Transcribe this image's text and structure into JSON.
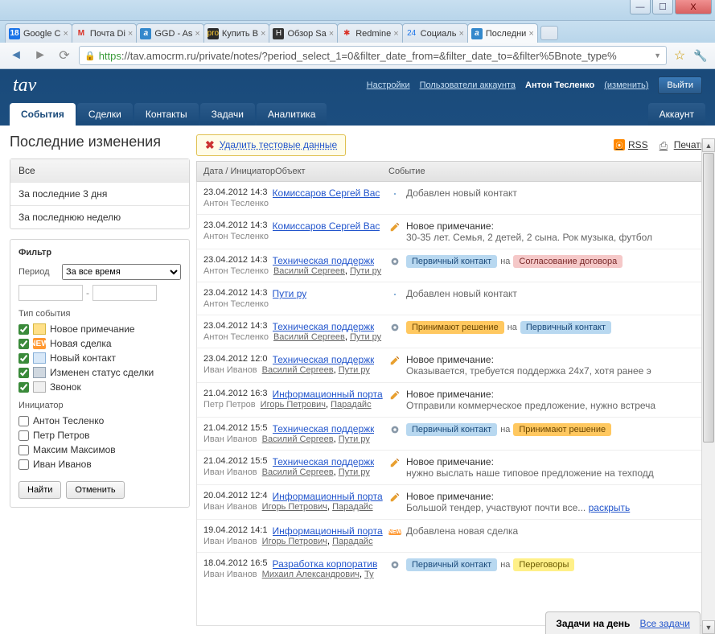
{
  "window": {
    "min": "—",
    "max": "☐",
    "close": "X"
  },
  "tabs": [
    {
      "label": "Google C",
      "fav": "18",
      "favcls": "fav-cal"
    },
    {
      "label": "Почта Di",
      "fav": "M",
      "favcls": "fav-gmail"
    },
    {
      "label": "GGD - As",
      "fav": "a",
      "favcls": "fav-a"
    },
    {
      "label": "Купить В",
      "fav": "pro",
      "favcls": "fav-pro"
    },
    {
      "label": "Обзор Sa",
      "fav": "H",
      "favcls": "fav-h"
    },
    {
      "label": "Redmine",
      "fav": "✱",
      "favcls": "fav-rm"
    },
    {
      "label": "Социаль",
      "fav": "24",
      "favcls": "fav-24"
    },
    {
      "label": "Последни",
      "fav": "a",
      "favcls": "fav-a",
      "active": true
    }
  ],
  "url": {
    "https": "https",
    "rest": "://tav.amocrm.ru/private/notes/?period_select_1=0&filter_date_from=&filter_date_to=&filter%5Bnote_type%"
  },
  "header": {
    "logo": "tav",
    "settings": "Настройки",
    "users": "Пользователи аккаунта",
    "username": "Антон Тесленко",
    "change": "(изменить)",
    "logout": "Выйти"
  },
  "nav": {
    "events": "События",
    "deals": "Сделки",
    "contacts": "Контакты",
    "tasks": "Задачи",
    "analytics": "Аналитика",
    "account": "Аккаунт"
  },
  "page_title": "Последние изменения",
  "quick": {
    "all": "Все",
    "days3": "За последние 3 дня",
    "week": "За последнюю неделю"
  },
  "filter": {
    "title": "Фильтр",
    "period_label": "Период",
    "period_value": "За все время",
    "type_title": "Тип события",
    "types": {
      "note": "Новое примечание",
      "deal": "Новая сделка",
      "contact": "Новый контакт",
      "status": "Изменен статус сделки",
      "call": "Звонок"
    },
    "initiator_title": "Инициатор",
    "initiators": [
      "Антон Тесленко",
      "Петр Петров",
      "Максим Максимов",
      "Иван Иванов"
    ],
    "find": "Найти",
    "cancel": "Отменить"
  },
  "top": {
    "del_test": "Удалить тестовые данные",
    "rss": "RSS",
    "print": "Печать"
  },
  "list_header": {
    "date": "Дата / ИнициаторОбъект",
    "event": "Событие"
  },
  "events": [
    {
      "date": "23.04.2012 14:3",
      "init": "Антон Тесленко",
      "obj": "Комиссаров Сергей Вас",
      "icon": "contact",
      "body_text": "Добавлен новый контакт"
    },
    {
      "date": "23.04.2012 14:3",
      "init": "Антон Тесленко",
      "obj": "Комиссаров Сергей Вас",
      "icon": "note",
      "body_title": "Новое примечание:",
      "body_text": "30-35 лет. Семья, 2 детей, 2 сына. Рок музыка, футбол"
    },
    {
      "date": "23.04.2012 14:3",
      "init": "Антон Тесленко",
      "obj": "Техническая поддержк",
      "sub": [
        "Василий Сергеев",
        "Пути ру"
      ],
      "icon": "gear",
      "tags": [
        {
          "cls": "tag-blue",
          "t": "Первичный контакт"
        },
        {
          "conn": "на"
        },
        {
          "cls": "tag-pink",
          "t": "Согласование договора"
        }
      ]
    },
    {
      "date": "23.04.2012 14:3",
      "init": "Антон Тесленко",
      "obj": "Пути ру",
      "icon": "contact",
      "body_text": "Добавлен новый контакт"
    },
    {
      "date": "23.04.2012 14:3",
      "init": "Антон Тесленко",
      "obj": "Техническая поддержк",
      "sub": [
        "Василий Сергеев",
        "Пути ру"
      ],
      "icon": "gear",
      "tags": [
        {
          "cls": "tag-orange",
          "t": "Принимают решение"
        },
        {
          "conn": "на"
        },
        {
          "cls": "tag-blue",
          "t": "Первичный контакт"
        }
      ]
    },
    {
      "date": "23.04.2012 12:0",
      "init": "Иван Иванов",
      "obj": "Техническая поддержк",
      "sub": [
        "Василий Сергеев",
        "Пути ру"
      ],
      "icon": "note",
      "body_title": "Новое примечание:",
      "body_text": "Оказывается, требуется поддержка 24x7, хотя ранее э"
    },
    {
      "date": "21.04.2012 16:3",
      "init": "Петр Петров",
      "obj": "Информационный порта",
      "sub": [
        "Игорь Петрович",
        "Парадайс"
      ],
      "icon": "note",
      "body_title": "Новое примечание:",
      "body_text": "Отправили коммерческое предложение, нужно встреча"
    },
    {
      "date": "21.04.2012 15:5",
      "init": "Иван Иванов",
      "obj": "Техническая поддержк",
      "sub": [
        "Василий Сергеев",
        "Пути ру"
      ],
      "icon": "gear",
      "tags": [
        {
          "cls": "tag-blue",
          "t": "Первичный контакт"
        },
        {
          "conn": "на"
        },
        {
          "cls": "tag-orange",
          "t": "Принимают решение"
        }
      ]
    },
    {
      "date": "21.04.2012 15:5",
      "init": "Иван Иванов",
      "obj": "Техническая поддержк",
      "sub": [
        "Василий Сергеев",
        "Пути ру"
      ],
      "icon": "note",
      "body_title": "Новое примечание:",
      "body_text": "нужно выслать наше типовое предложение на техподд"
    },
    {
      "date": "20.04.2012 12:4",
      "init": "Иван Иванов",
      "obj": "Информационный порта",
      "sub": [
        "Игорь Петрович",
        "Парадайс"
      ],
      "icon": "note",
      "body_title": "Новое примечание:",
      "body_text": "Большой тендер, участвуют почти все... ",
      "expand": "раскрыть"
    },
    {
      "date": "19.04.2012 14:1",
      "init": "Иван Иванов",
      "obj": "Информационный порта",
      "sub": [
        "Игорь Петрович",
        "Парадайс"
      ],
      "icon": "new",
      "body_text": "Добавлена новая сделка"
    },
    {
      "date": "18.04.2012 16:5",
      "init": "Иван Иванов",
      "obj": "Разработка корпоратив",
      "sub": [
        "Михаил Александрович",
        "Ту"
      ],
      "icon": "gear",
      "tags": [
        {
          "cls": "tag-blue",
          "t": "Первичный контакт"
        },
        {
          "conn": "на"
        },
        {
          "cls": "tag-yellow",
          "t": "Переговоры"
        }
      ]
    }
  ],
  "taskbar": {
    "title": "Задачи на день",
    "all": "Все задачи"
  }
}
